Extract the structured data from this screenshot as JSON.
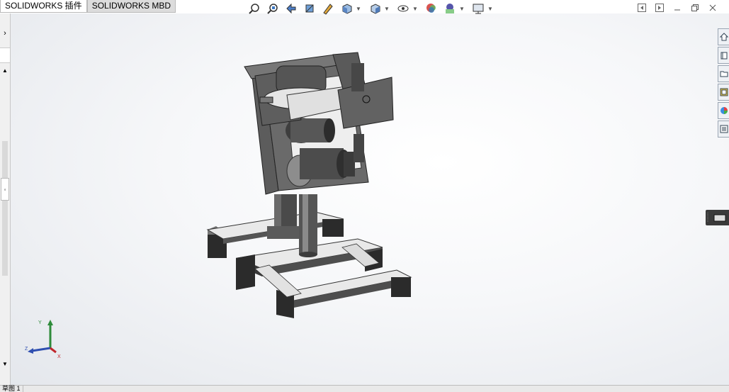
{
  "tabs": [
    {
      "label": "SOLIDWORKS 插件",
      "active": true
    },
    {
      "label": "SOLIDWORKS MBD",
      "active": false
    }
  ],
  "hud_toolbar": {
    "icons": [
      "zoom-to-fit-icon",
      "zoom-to-area-icon",
      "previous-view-icon",
      "section-view-icon",
      "dynamic-annotation-icon",
      "view-orientation-icon",
      "display-style-icon",
      "hide-show-items-icon",
      "edit-appearance-icon",
      "apply-scene-icon",
      "view-settings-icon"
    ]
  },
  "triad": {
    "x": "X",
    "y": "Y",
    "z": "Z"
  },
  "status": {
    "label": "草图 1"
  },
  "colors": {
    "part_fill": "#6b6b6b",
    "part_dark": "#3f3f3f",
    "part_light": "#9a9a9a",
    "triad_x": "#c0272d",
    "triad_y": "#2e8b3a",
    "triad_z": "#2f4fb0"
  }
}
